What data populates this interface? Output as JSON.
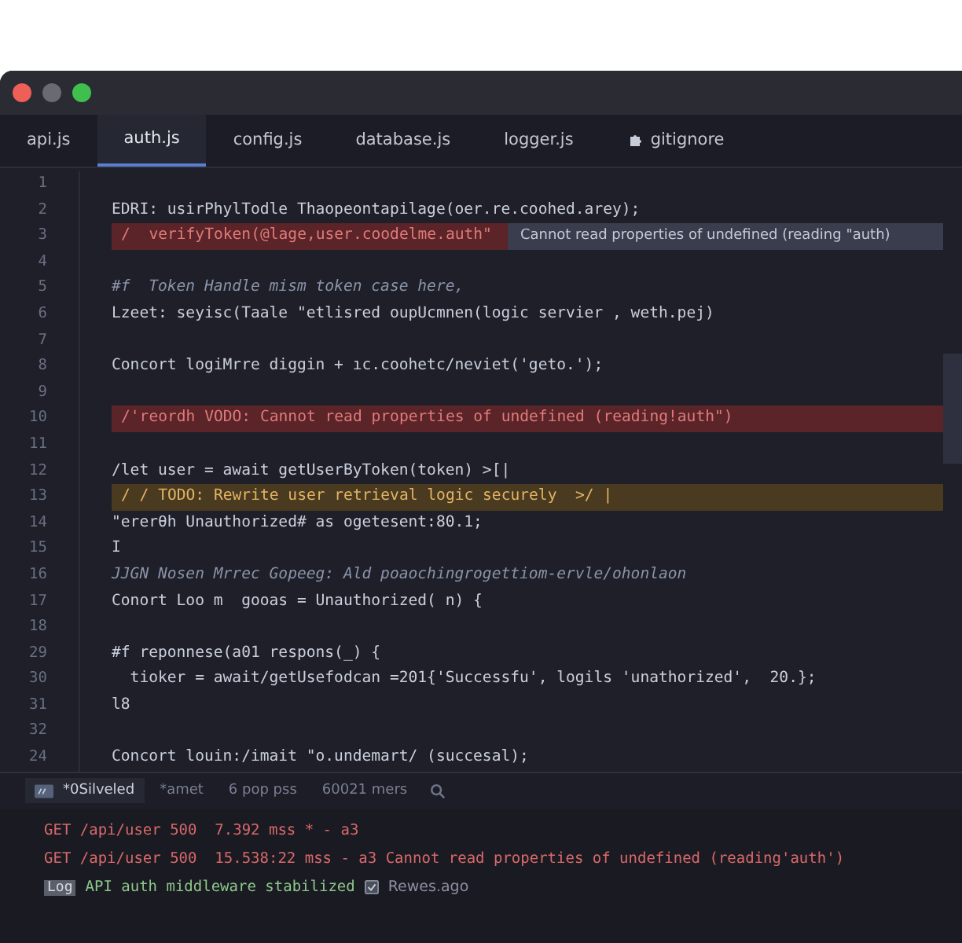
{
  "tabs": [
    {
      "label": "api.js",
      "selected": false,
      "icon": false
    },
    {
      "label": "auth.js",
      "selected": true,
      "icon": false
    },
    {
      "label": "config.js",
      "selected": false,
      "icon": false
    },
    {
      "label": "database.js",
      "selected": false,
      "icon": false
    },
    {
      "label": "logger.js",
      "selected": false,
      "icon": false
    },
    {
      "label": "gitignore",
      "selected": false,
      "icon": true
    }
  ],
  "code_lines": [
    {
      "num": "1"
    },
    {
      "num": "2",
      "text": "EDRI: usirPhylTodle Thaopeontapilage(oer.re.coohed.arey);",
      "kind": "plain"
    },
    {
      "num": "3",
      "text": "/  verifyToken(@lage,user.coodelme.auth\"",
      "kind": "error",
      "message": "Cannot read properties of undefined (reading \"auth)"
    },
    {
      "num": "4"
    },
    {
      "num": "5",
      "text": "#f  Token Handle mism token case here,",
      "kind": "comment"
    },
    {
      "num": "6",
      "text": "Lzeet: seyisc(Taale \"etlisred oupUcmnen(logic servier , weth.pej)",
      "kind": "plain"
    },
    {
      "num": "7"
    },
    {
      "num": "8",
      "text": "Concort logiMrre diggin + ıc.coohetc/neviet('geto.');",
      "kind": "plain"
    },
    {
      "num": "9"
    },
    {
      "num": "10",
      "text": "/'reordh VODO: Cannot read properties of undefined (reading!auth\")",
      "kind": "error"
    },
    {
      "num": "11"
    },
    {
      "num": "12",
      "text": "/let user = await getUserByToken(token) >[|",
      "kind": "plain"
    },
    {
      "num": "13",
      "text": "/ / TODO: Rewrite user retrieval logic securely  >/ |",
      "kind": "warning"
    },
    {
      "num": "14",
      "text": "\"ererθh Unauthorized# as ogetesent:80.1;",
      "kind": "plain"
    },
    {
      "num": "15",
      "text": "I",
      "kind": "plain"
    },
    {
      "num": "16",
      "text": "JJGN Nosen Mrrec Gopeeg: Ald poaochingrogettiom-ervle/ohonlaon",
      "kind": "comment"
    },
    {
      "num": "17",
      "text": "Conort Loo m  gooas = Unauthorized( n) {",
      "kind": "plain"
    },
    {
      "num": "18"
    },
    {
      "num": "29",
      "text": "#f reponnese(a01 respons(_) {",
      "kind": "plain"
    },
    {
      "num": "30",
      "text": "  tioker = await/getUsefodcan =201{'Successfu', logils 'unathorized',  20.};",
      "kind": "plain"
    },
    {
      "num": "31",
      "text": "l8",
      "kind": "plain"
    },
    {
      "num": "32"
    },
    {
      "num": "24",
      "text": "Concort louin:/imait \"o.undemart/ (succesal);",
      "kind": "plain"
    }
  ],
  "panel_tabs": [
    {
      "label": "*0Silveled",
      "selected": true
    },
    {
      "label": "*amet",
      "selected": false
    },
    {
      "label": "6 pop pss",
      "selected": false
    },
    {
      "label": "60021 mers",
      "selected": false
    }
  ],
  "log": [
    {
      "kind": "error",
      "text": "GET /api/user 500  7.392 mss * - a3"
    },
    {
      "kind": "error",
      "text": "GET /api/user 500  15.538:22 mss - a3 Cannot read properties of undefined (reading'auth')"
    },
    {
      "kind": "success",
      "badge": "Log",
      "text": "API auth middleware stabilized",
      "time": "Rewes.ago"
    }
  ]
}
